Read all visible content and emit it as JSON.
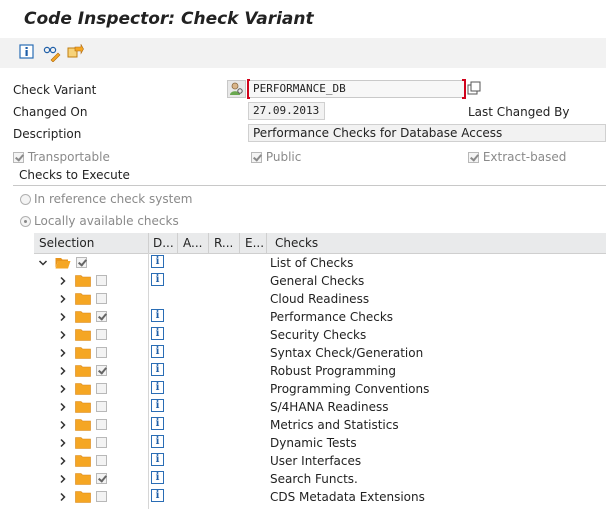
{
  "window": {
    "title": "Code Inspector: Check Variant"
  },
  "toolbar": {
    "buttons": [
      {
        "name": "info-icon"
      },
      {
        "name": "glasses-icon"
      },
      {
        "name": "transport-icon"
      }
    ]
  },
  "header": {
    "check_variant_label": "Check Variant",
    "check_variant_value": "PERFORMANCE_DB",
    "changed_on_label": "Changed On",
    "changed_on_value": "27.09.2013",
    "last_changed_by_label": "Last Changed By",
    "description_label": "Description",
    "description_value": "Performance Checks for Database Access",
    "transportable_label": "Transportable",
    "public_label": "Public",
    "extract_based_label": "Extract-based"
  },
  "checks_section": {
    "title": "Checks to Execute",
    "radio_reference": "In reference check system",
    "radio_local": "Locally available checks"
  },
  "grid": {
    "headers": [
      "Selection",
      "D...",
      "A...",
      "R...",
      "E...",
      "Checks"
    ],
    "root": {
      "label": "List of Checks",
      "checked": true,
      "info": true
    },
    "rows": [
      {
        "label": "General Checks",
        "checked": false,
        "info": true
      },
      {
        "label": "Cloud Readiness",
        "checked": false,
        "info": false
      },
      {
        "label": "Performance Checks",
        "checked": true,
        "info": true
      },
      {
        "label": "Security Checks",
        "checked": false,
        "info": true
      },
      {
        "label": "Syntax Check/Generation",
        "checked": false,
        "info": true
      },
      {
        "label": "Robust Programming",
        "checked": true,
        "info": true
      },
      {
        "label": "Programming Conventions",
        "checked": false,
        "info": true
      },
      {
        "label": "S/4HANA Readiness",
        "checked": false,
        "info": true
      },
      {
        "label": "Metrics and Statistics",
        "checked": false,
        "info": true
      },
      {
        "label": "Dynamic Tests",
        "checked": false,
        "info": true
      },
      {
        "label": "User Interfaces",
        "checked": false,
        "info": true
      },
      {
        "label": "Search Functs.",
        "checked": true,
        "info": true
      },
      {
        "label": "CDS Metadata Extensions",
        "checked": false,
        "info": true
      }
    ]
  },
  "colors": {
    "folder": "#f5a623",
    "info": "#1f5fa8",
    "required_marker": "#d0021b"
  }
}
